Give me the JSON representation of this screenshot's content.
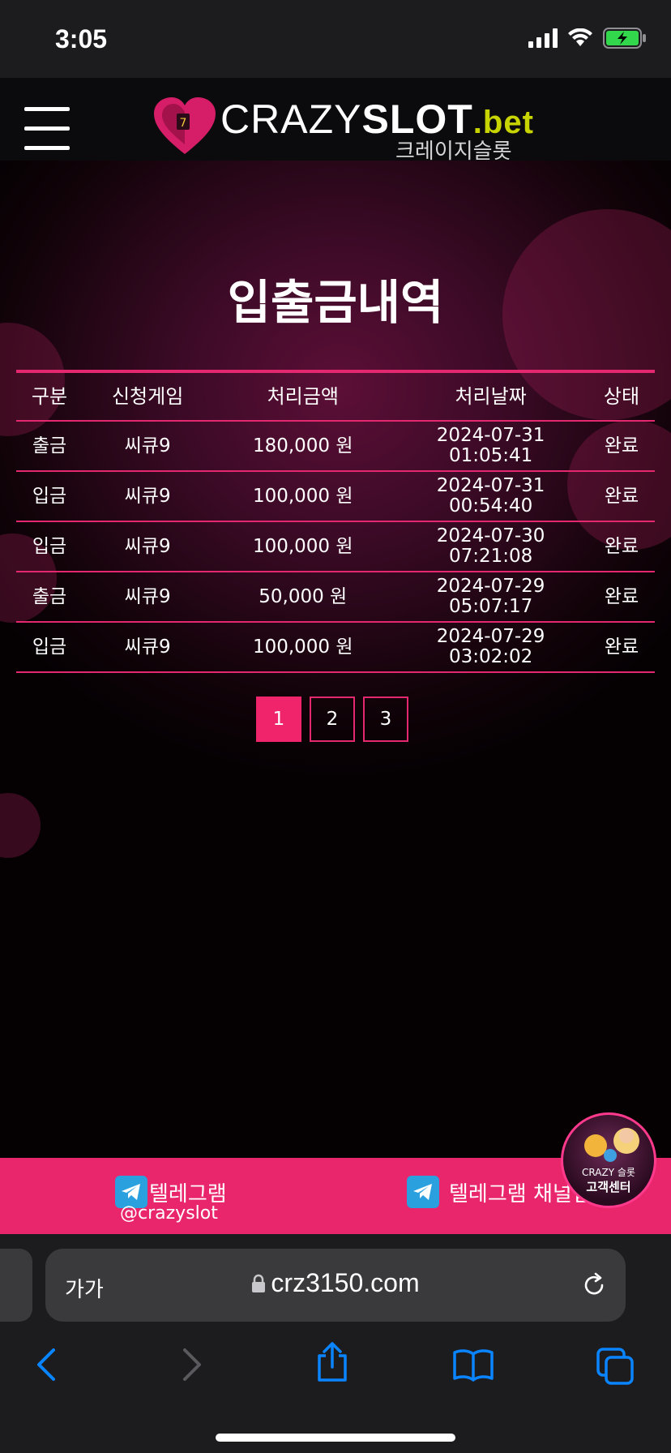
{
  "status_bar": {
    "time": "3:05"
  },
  "header": {
    "logo_crazy": "CRAZY",
    "logo_slot": "SLOT",
    "logo_bet": ".bet",
    "logo_sub": "크레이지슬롯"
  },
  "page": {
    "title": "입출금내역"
  },
  "table": {
    "headers": [
      "구분",
      "신청게임",
      "처리금액",
      "처리날짜",
      "상태"
    ],
    "rows": [
      {
        "type": "출금",
        "game": "씨큐9",
        "amount": "180,000 원",
        "date": "2024-07-31",
        "time": "01:05:41",
        "status": "완료"
      },
      {
        "type": "입금",
        "game": "씨큐9",
        "amount": "100,000 원",
        "date": "2024-07-31",
        "time": "00:54:40",
        "status": "완료"
      },
      {
        "type": "입금",
        "game": "씨큐9",
        "amount": "100,000 원",
        "date": "2024-07-30",
        "time": "07:21:08",
        "status": "완료"
      },
      {
        "type": "출금",
        "game": "씨큐9",
        "amount": "50,000 원",
        "date": "2024-07-29",
        "time": "05:07:17",
        "status": "완료"
      },
      {
        "type": "입금",
        "game": "씨큐9",
        "amount": "100,000 원",
        "date": "2024-07-29",
        "time": "03:02:02",
        "status": "완료"
      }
    ]
  },
  "pagination": {
    "pages": [
      "1",
      "2",
      "3"
    ],
    "current": "1"
  },
  "footer": {
    "telegram_label": "텔레그램",
    "telegram_handle": "@crazyslot",
    "telegram_channel_label": "텔레그램 채널입",
    "cs_badge_top": "CRAZY 슬롯",
    "cs_badge_label": "고객센터"
  },
  "browser": {
    "text_size_label": "가가",
    "url": "crz3150.com"
  },
  "colors": {
    "accent": "#e9256c",
    "active_page": "#f0246b",
    "browser_icon": "#0a84ff",
    "logo_bet": "#c8d400"
  },
  "icons": [
    "menu-icon",
    "heart-logo-icon",
    "telegram-icon",
    "lock-icon",
    "reload-icon",
    "back-icon",
    "forward-icon",
    "share-icon",
    "bookmarks-icon",
    "tabs-icon",
    "signal-icon",
    "wifi-icon",
    "battery-icon"
  ]
}
